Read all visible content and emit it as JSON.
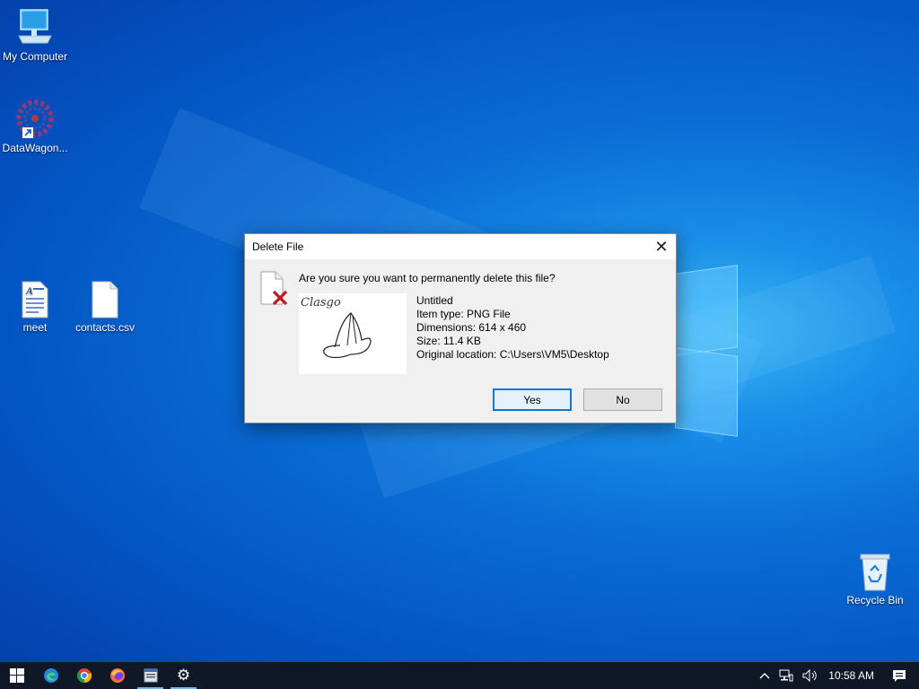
{
  "desktop": {
    "icons": {
      "my_computer": "My Computer",
      "datawagon": "DataWagon...",
      "meet": "meet",
      "contacts": "contacts.csv",
      "recycle_bin": "Recycle Bin"
    }
  },
  "dialog": {
    "title": "Delete File",
    "message": "Are you sure you want to permanently delete this file?",
    "file_name": "Untitled",
    "item_type": "Item type: PNG File",
    "dimensions": "Dimensions: 614 x 460",
    "size": "Size: 11.4 KB",
    "location": "Original location: C:\\Users\\VM5\\Desktop",
    "thumbnail_text": "Clasgo",
    "yes_label": "Yes",
    "no_label": "No"
  },
  "taskbar": {
    "apps": [
      "start-icon",
      "edge-icon",
      "chrome-icon",
      "firefox-icon",
      "app-window-icon",
      "gear-icon"
    ],
    "time": "10:58 AM"
  },
  "colors": {
    "accent": "#0078d7",
    "taskbar": "#101828",
    "desktop": "#0a6fd6"
  }
}
